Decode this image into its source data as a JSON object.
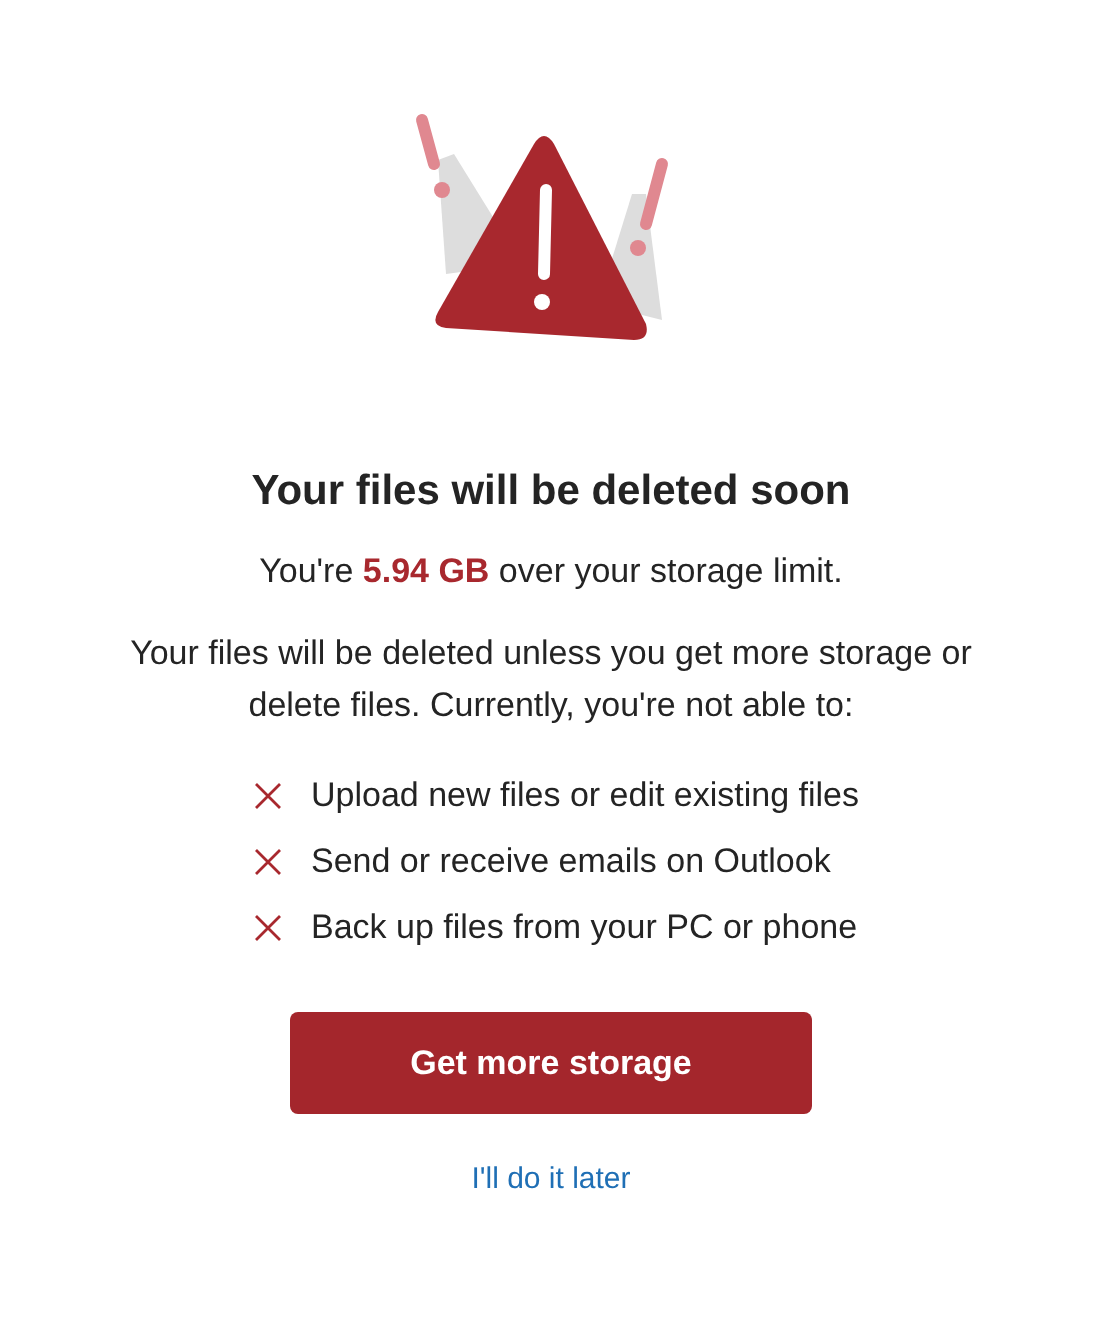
{
  "title": "Your files will be deleted soon",
  "summary": "You're **5.94 GB** over your storage limit.",
  "explanation": "Your files will be deleted unless you get more storage or delete files. Currently, you're not able to:",
  "restrictions": [
    "Upload new files or edit existing files",
    "Send or receive emails on Outlook",
    "Back up files from your PC or phone"
  ],
  "primary_button": "Get more storage",
  "secondary_link": "I'll do it later"
}
